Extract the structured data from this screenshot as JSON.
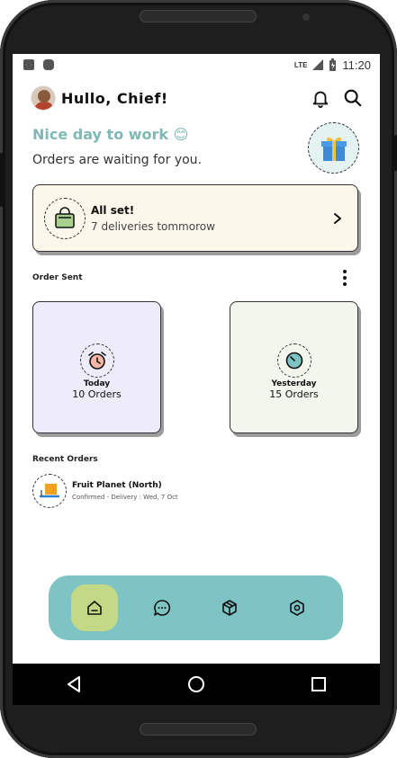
{
  "status": {
    "time": "11:20",
    "network": "LTE"
  },
  "header": {
    "greeting": "Hullo, Chief!"
  },
  "hero": {
    "title": "Nice day to work 😊",
    "subtitle": "Orders are waiting for you."
  },
  "allset": {
    "title": "All set!",
    "subtitle": "7 deliveries tommorow"
  },
  "orders_sent": {
    "title": "Order Sent",
    "cards": [
      {
        "label": "Today",
        "count": "10 Orders",
        "bg": "#eeecfb"
      },
      {
        "label": "Yesterday",
        "count": "15 Orders",
        "bg": "#f2f6ec"
      }
    ]
  },
  "recent": {
    "title": "Recent Orders",
    "items": [
      {
        "name": "Fruit Planet (North)",
        "detail": "Confirmed - Delivery : Wed, 7 Oct"
      }
    ]
  },
  "colors": {
    "accent": "#7fb8b5",
    "nav_bg": "#7fc4c5",
    "nav_active": "#c4d985",
    "allset_bg": "#fbf7ea"
  },
  "icons": {
    "nav": [
      "home-icon",
      "chat-icon",
      "package-icon",
      "settings-icon"
    ],
    "system": [
      "back-icon",
      "home-circle-icon",
      "recents-icon"
    ]
  }
}
